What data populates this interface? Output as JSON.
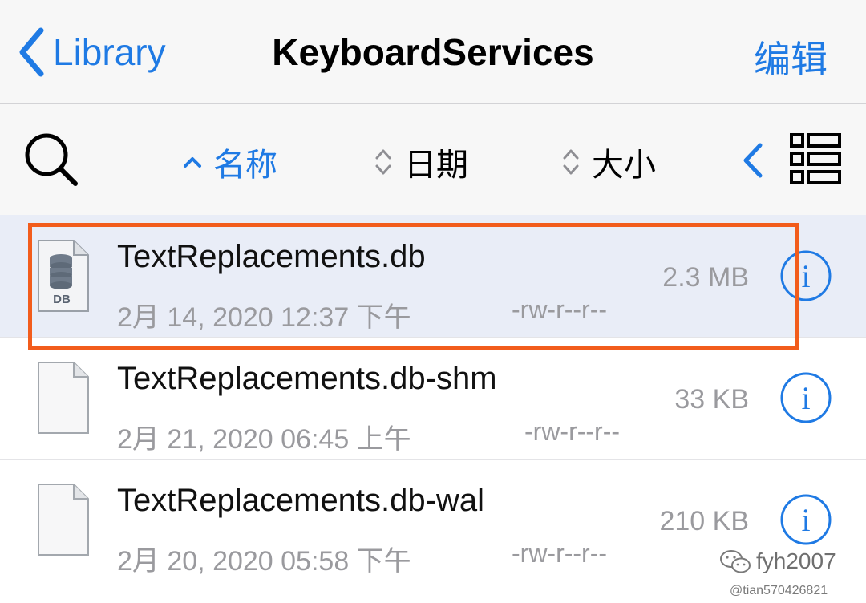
{
  "navbar": {
    "back_label": "Library",
    "title": "KeyboardServices",
    "edit_label": "编辑"
  },
  "toolbar": {
    "sort_name": "名称",
    "sort_date": "日期",
    "sort_size": "大小"
  },
  "files": [
    {
      "name": "TextReplacements.db",
      "date": "2月 14, 2020 12:37 下午",
      "perm": "-rw-r--r--",
      "size": "2.3 MB",
      "icon_badge": "DB"
    },
    {
      "name": "TextReplacements.db-shm",
      "date": "2月 21, 2020 06:45 上午",
      "perm": "-rw-r--r--",
      "size": "33 KB"
    },
    {
      "name": "TextReplacements.db-wal",
      "date": "2月 20, 2020 05:58 下午",
      "perm": "-rw-r--r--",
      "size": "210 KB"
    }
  ],
  "watermark": {
    "line1": "fyh2007",
    "line2": "@tian570426821"
  },
  "colors": {
    "accent": "#1f7ae4",
    "highlight": "#f25c1c",
    "selected_row": "#e9edf7"
  },
  "icons": [
    "chevron-left-icon",
    "search-icon",
    "sort-ascending-icon",
    "sort-both-icon",
    "list-view-icon",
    "database-file-icon",
    "blank-file-icon",
    "info-icon",
    "wechat-icon"
  ]
}
